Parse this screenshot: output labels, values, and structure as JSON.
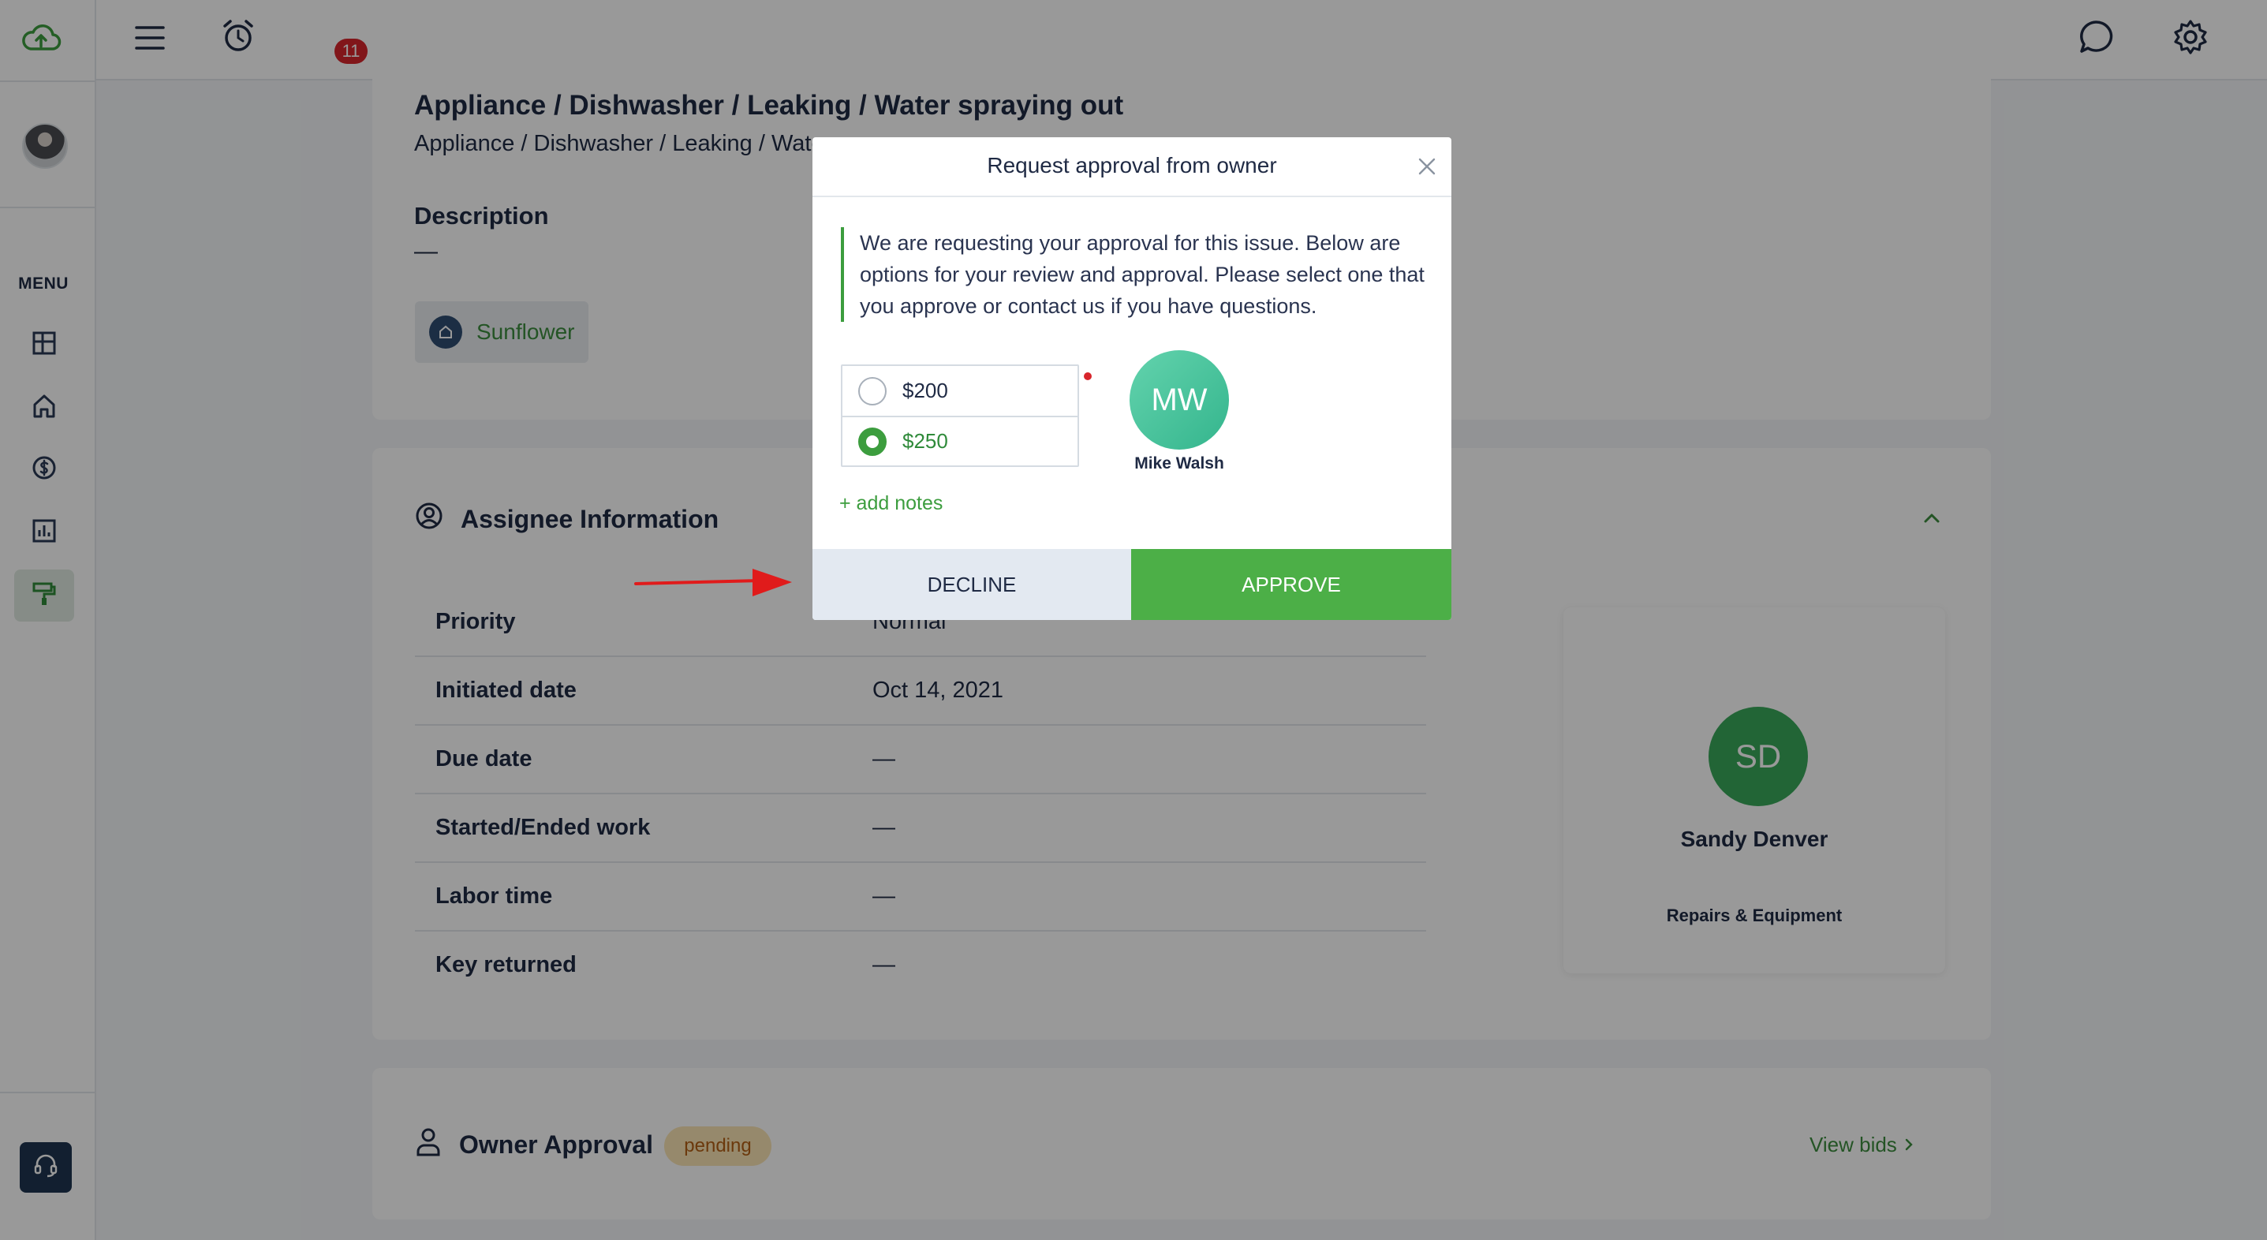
{
  "colors": {
    "accent_green": "#4caf47",
    "link_green": "#3c8d3e",
    "navy": "#1f2a44",
    "badge_red": "#d8252c",
    "pending_bg": "#fbe4b4",
    "pending_text": "#b35f14"
  },
  "topbar": {
    "notification_count": "11",
    "icons": [
      "menu-icon",
      "alarm-clock-icon",
      "chat-icon",
      "gear-icon"
    ]
  },
  "sidebar": {
    "menu_label": "MENU",
    "items": [
      {
        "icon": "dashboard-icon"
      },
      {
        "icon": "home-icon"
      },
      {
        "icon": "dollar-icon"
      },
      {
        "icon": "chart-icon"
      },
      {
        "icon": "paint-roller-icon",
        "active": true
      }
    ]
  },
  "issue": {
    "title": "Appliance / Dishwasher / Leaking / Water spraying out",
    "subtitle": "Appliance / Dishwasher / Leaking / Water",
    "description_label": "Description",
    "description_value": "—",
    "property_chip": "Sunflower"
  },
  "assignee": {
    "section_title": "Assignee Information",
    "rows": [
      {
        "label": "Priority",
        "value": "Normal"
      },
      {
        "label": "Initiated date",
        "value": "Oct 14, 2021"
      },
      {
        "label": "Due date",
        "value": "—"
      },
      {
        "label": "Started/Ended work",
        "value": "—"
      },
      {
        "label": "Labor time",
        "value": "—"
      },
      {
        "label": "Key returned",
        "value": "—"
      }
    ],
    "card": {
      "initials": "SD",
      "name": "Sandy Denver",
      "role": "Repairs & Equipment"
    }
  },
  "owner_approval": {
    "title": "Owner Approval",
    "status": "pending",
    "view_bids": "View bids"
  },
  "modal": {
    "title": "Request approval from owner",
    "message": "We are requesting your approval for this issue. Below are options for your review and approval. Please select one that you approve or contact us if you have questions.",
    "options": [
      {
        "label": "$200",
        "selected": false
      },
      {
        "label": "$250",
        "selected": true
      }
    ],
    "owner_initials": "MW",
    "owner_name": "Mike Walsh",
    "add_notes": "+ add notes",
    "decline_label": "DECLINE",
    "approve_label": "APPROVE"
  }
}
